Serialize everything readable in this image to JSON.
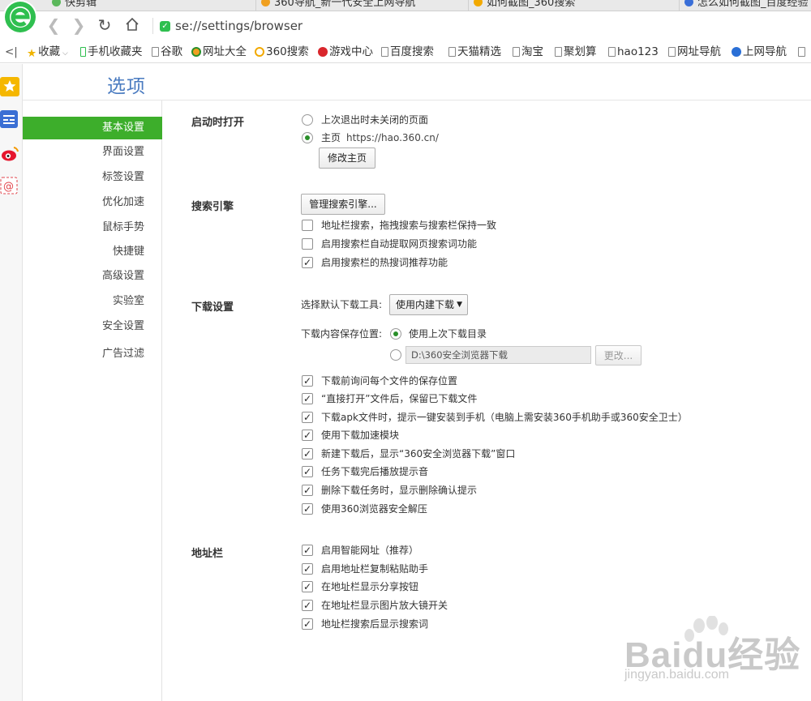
{
  "tabs": [
    {
      "label": "快剪辑",
      "icon": "scissors-icon",
      "color": "#5cb85c"
    },
    {
      "label": "360导航_新一代安全上网导航",
      "icon": "360-nav-icon",
      "color": "#f0a020"
    },
    {
      "label": "如何截图_360搜索",
      "icon": "360-search-icon",
      "color": "#f2a900"
    },
    {
      "label": "怎么如何截图_百度经验",
      "icon": "baidu-icon",
      "color": "#3a6fd8"
    }
  ],
  "address": {
    "url": "se://settings/browser"
  },
  "bookmarks": [
    {
      "label": "收藏",
      "icon": "star-icon",
      "dropdown": true
    },
    {
      "label": "手机收藏夹",
      "icon": "phone-icon"
    },
    {
      "label": "谷歌",
      "icon": "page-icon"
    },
    {
      "label": "网址大全",
      "icon": "360-nav-icon"
    },
    {
      "label": "360搜索",
      "icon": "360-search-icon"
    },
    {
      "label": "游戏中心",
      "icon": "game-icon"
    },
    {
      "label": "百度搜索",
      "icon": "page-icon"
    },
    {
      "label": "天猫精选",
      "icon": "page-icon"
    },
    {
      "label": "淘宝",
      "icon": "page-icon"
    },
    {
      "label": "聚划算",
      "icon": "page-icon"
    },
    {
      "label": "hao123",
      "icon": "page-icon"
    },
    {
      "label": "网址导航",
      "icon": "page-icon"
    },
    {
      "label": "上网导航",
      "icon": "ie-icon"
    }
  ],
  "page_title": "选项",
  "nav": [
    {
      "label": "基本设置",
      "active": true
    },
    {
      "label": "界面设置"
    },
    {
      "label": "标签设置"
    },
    {
      "label": "优化加速"
    },
    {
      "label": "鼠标手势"
    },
    {
      "label": "快捷键"
    },
    {
      "label": "高级设置"
    },
    {
      "label": "实验室"
    },
    {
      "label": "安全设置"
    },
    {
      "label": "广告过滤"
    }
  ],
  "startup": {
    "title": "启动时打开",
    "option_last": "上次退出时未关闭的页面",
    "option_home": "主页",
    "home_url": "https://hao.360.cn/",
    "selected": "home",
    "change_home_button": "修改主页"
  },
  "search": {
    "title": "搜索引擎",
    "manage_button": "管理搜索引擎...",
    "options": [
      {
        "label": "地址栏搜索，拖拽搜索与搜索栏保持一致",
        "checked": false
      },
      {
        "label": "启用搜索栏自动提取网页搜索词功能",
        "checked": false
      },
      {
        "label": "启用搜索栏的热搜词推荐功能",
        "checked": true
      }
    ]
  },
  "download": {
    "title": "下载设置",
    "tool_label": "选择默认下载工具:",
    "tool_value": "使用内建下载",
    "location_label": "下载内容保存位置:",
    "use_last_dir": "使用上次下载目录",
    "location_selected": "last",
    "custom_path": "D:\\360安全浏览器下载",
    "change_button": "更改...",
    "options": [
      {
        "label": "下载前询问每个文件的保存位置",
        "checked": true
      },
      {
        "label": "“直接打开”文件后，保留已下载文件",
        "checked": true
      },
      {
        "label": "下载apk文件时，提示一键安装到手机（电脑上需安装360手机助手或360安全卫士）",
        "checked": true
      },
      {
        "label": "使用下载加速模块",
        "checked": true
      },
      {
        "label": "新建下载后，显示“360安全浏览器下载”窗口",
        "checked": true
      },
      {
        "label": "任务下载完后播放提示音",
        "checked": true
      },
      {
        "label": "删除下载任务时，显示删除确认提示",
        "checked": true
      },
      {
        "label": "使用360浏览器安全解压",
        "checked": true
      }
    ]
  },
  "addressbar": {
    "title": "地址栏",
    "options": [
      {
        "label": "启用智能网址（推荐）",
        "checked": true
      },
      {
        "label": "启用地址栏复制粘贴助手",
        "checked": true
      },
      {
        "label": "在地址栏显示分享按钮",
        "checked": true
      },
      {
        "label": "在地址栏显示图片放大镜开关",
        "checked": true
      },
      {
        "label": "地址栏搜索后显示搜索词",
        "checked": true
      }
    ]
  },
  "watermark": {
    "brand": "Baidu经验",
    "url": "jingyan.baidu.com"
  },
  "colors": {
    "accent_green": "#3dae2b",
    "title_blue": "#4a7bc0"
  }
}
